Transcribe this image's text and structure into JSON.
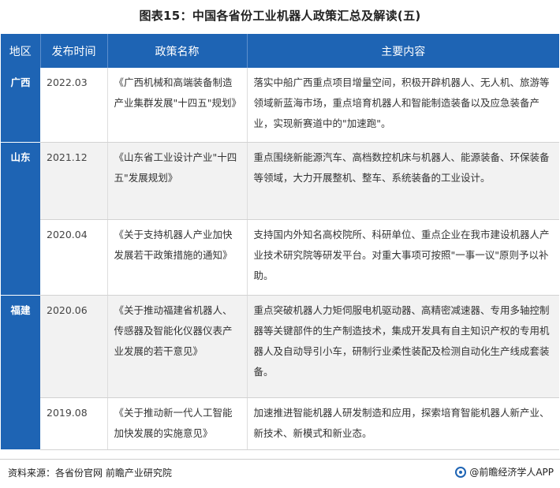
{
  "title": "图表15：中国各省份工业机器人政策汇总及解读(五)",
  "table": {
    "headers": [
      "地区",
      "发布时间",
      "政策名称",
      "主要内容"
    ],
    "rows": [
      {
        "region": "广西",
        "date": "2022.03",
        "policy": "《广西机械和高端装备制造产业集群发展\"十四五\"规划》",
        "content": "落实中船广西重点项目增量空间，积极开辟机器人、无人机、旅游等领域新蓝海市场，重点培育机器人和智能制造装备以及应急装备产业，实现新赛道中的\"加速跑\"。"
      },
      {
        "region": "山东",
        "date": "2021.12",
        "policy": "《山东省工业设计产业\"十四五\"发展规划》",
        "content": "重点围绕新能源汽车、高档数控机床与机器人、能源装备、环保装备等领域，大力开展整机、整车、系统装备的工业设计。"
      },
      {
        "region": "",
        "date": "2020.04",
        "policy": "《关于支持机器人产业加快发展若干政策措施的通知》",
        "content": "支持国内外知名高校院所、科研单位、重点企业在我市建设机器人产业技术研究院等研发平台。对重大事项可按照\"一事一议\"原则予以补助。"
      },
      {
        "region": "福建",
        "date": "2020.06",
        "policy": "《关于推动福建省机器人、传感器及智能化仪器仪表产业发展的若干意见》",
        "content": "重点突破机器人力矩伺服电机驱动器、高精密减速器、专用多轴控制器等关键部件的生产制造技术，集成开发具有自主知识产权的专用机器人及自动导引小车，研制行业柔性装配及检测自动化生产线成套装备。"
      },
      {
        "region": "",
        "date": "2019.08",
        "policy": "《关于推动新一代人工智能加快发展的实施意见》",
        "content": "加速推进智能机器人研发制造和应用，探索培育智能机器人新产业、新技术、新模式和新业态。"
      }
    ]
  },
  "footer": {
    "source": "资料来源：各省份官网 前瞻产业研究院",
    "brand": "@前瞻经济学人APP"
  },
  "colors": {
    "header_bg": "#1e64b4",
    "row_shade": "#f2f2f2"
  }
}
